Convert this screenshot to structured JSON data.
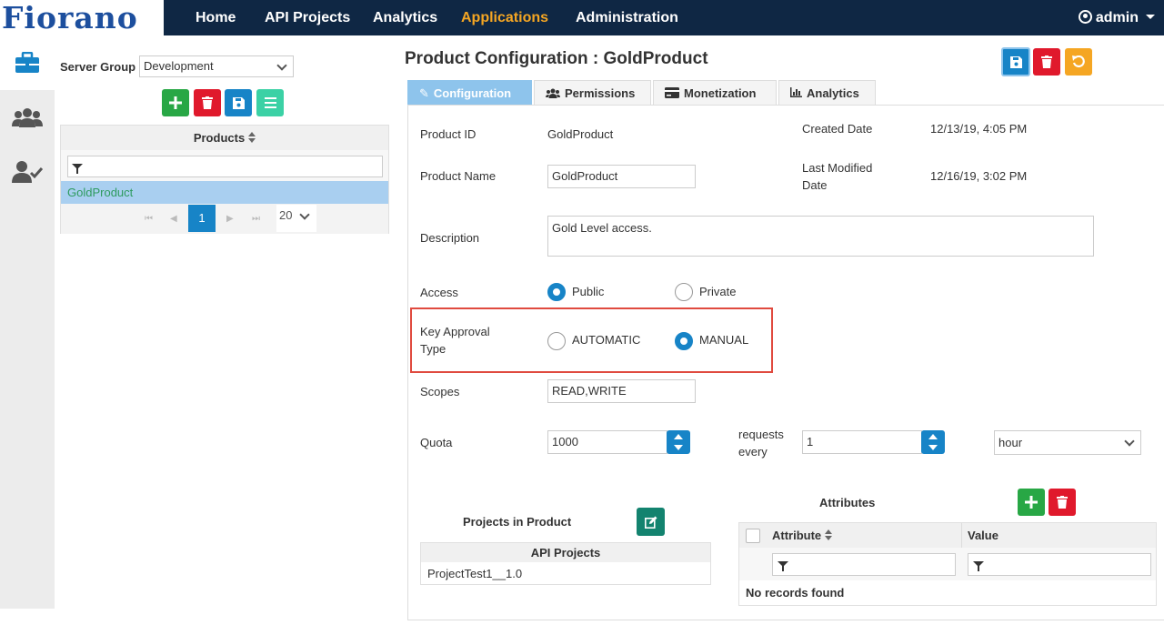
{
  "brand": {
    "logo_text": "Fiorano"
  },
  "nav": {
    "items": [
      "Home",
      "API Projects",
      "Analytics",
      "Applications",
      "Administration"
    ],
    "active": "Applications",
    "user": "admin"
  },
  "rail": {
    "icons": [
      "briefcase-icon",
      "users-icon",
      "user-check-icon"
    ]
  },
  "left_panel": {
    "server_group_label": "Server Group",
    "server_group_value": "Development",
    "grid_header": "Products",
    "rows": [
      "GoldProduct"
    ],
    "pager": {
      "current_page": "1",
      "page_size": "20"
    }
  },
  "page": {
    "title": "Product Configuration : GoldProduct",
    "tabs": [
      "Configuration",
      "Permissions",
      "Monetization",
      "Analytics"
    ],
    "active_tab": "Configuration"
  },
  "form": {
    "product_id_label": "Product ID",
    "product_id_value": "GoldProduct",
    "product_name_label": "Product Name",
    "product_name_value": "GoldProduct",
    "created_label": "Created Date",
    "created_value": "12/13/19, 4:05 PM",
    "modified_label_1": "Last Modified",
    "modified_label_2": "Date",
    "modified_value": "12/16/19, 3:02 PM",
    "description_label": "Description",
    "description_value": "Gold Level access.",
    "access_label": "Access",
    "access_options": [
      "Public",
      "Private"
    ],
    "access_selected": "Public",
    "key_approval_label_1": "Key Approval",
    "key_approval_label_2": "Type",
    "key_approval_options": [
      "AUTOMATIC",
      "MANUAL"
    ],
    "key_approval_selected": "MANUAL",
    "scopes_label": "Scopes",
    "scopes_value": "READ,WRITE",
    "quota_label": "Quota",
    "quota_value": "1000",
    "requests_label_1": "requests",
    "requests_label_2": "every",
    "requests_every_value": "1",
    "period_value": "hour"
  },
  "projects": {
    "title": "Projects in Product",
    "column": "API Projects",
    "rows": [
      "ProjectTest1__1.0"
    ]
  },
  "attributes": {
    "title": "Attributes",
    "columns": [
      "Attribute",
      "Value"
    ],
    "empty_text": "No records found"
  },
  "colors": {
    "navbar": "#0f2744",
    "accent": "#f5a623",
    "primary": "#1784c7",
    "danger": "#e0192c",
    "success": "#28a745",
    "highlight_border": "#e04a3f"
  }
}
